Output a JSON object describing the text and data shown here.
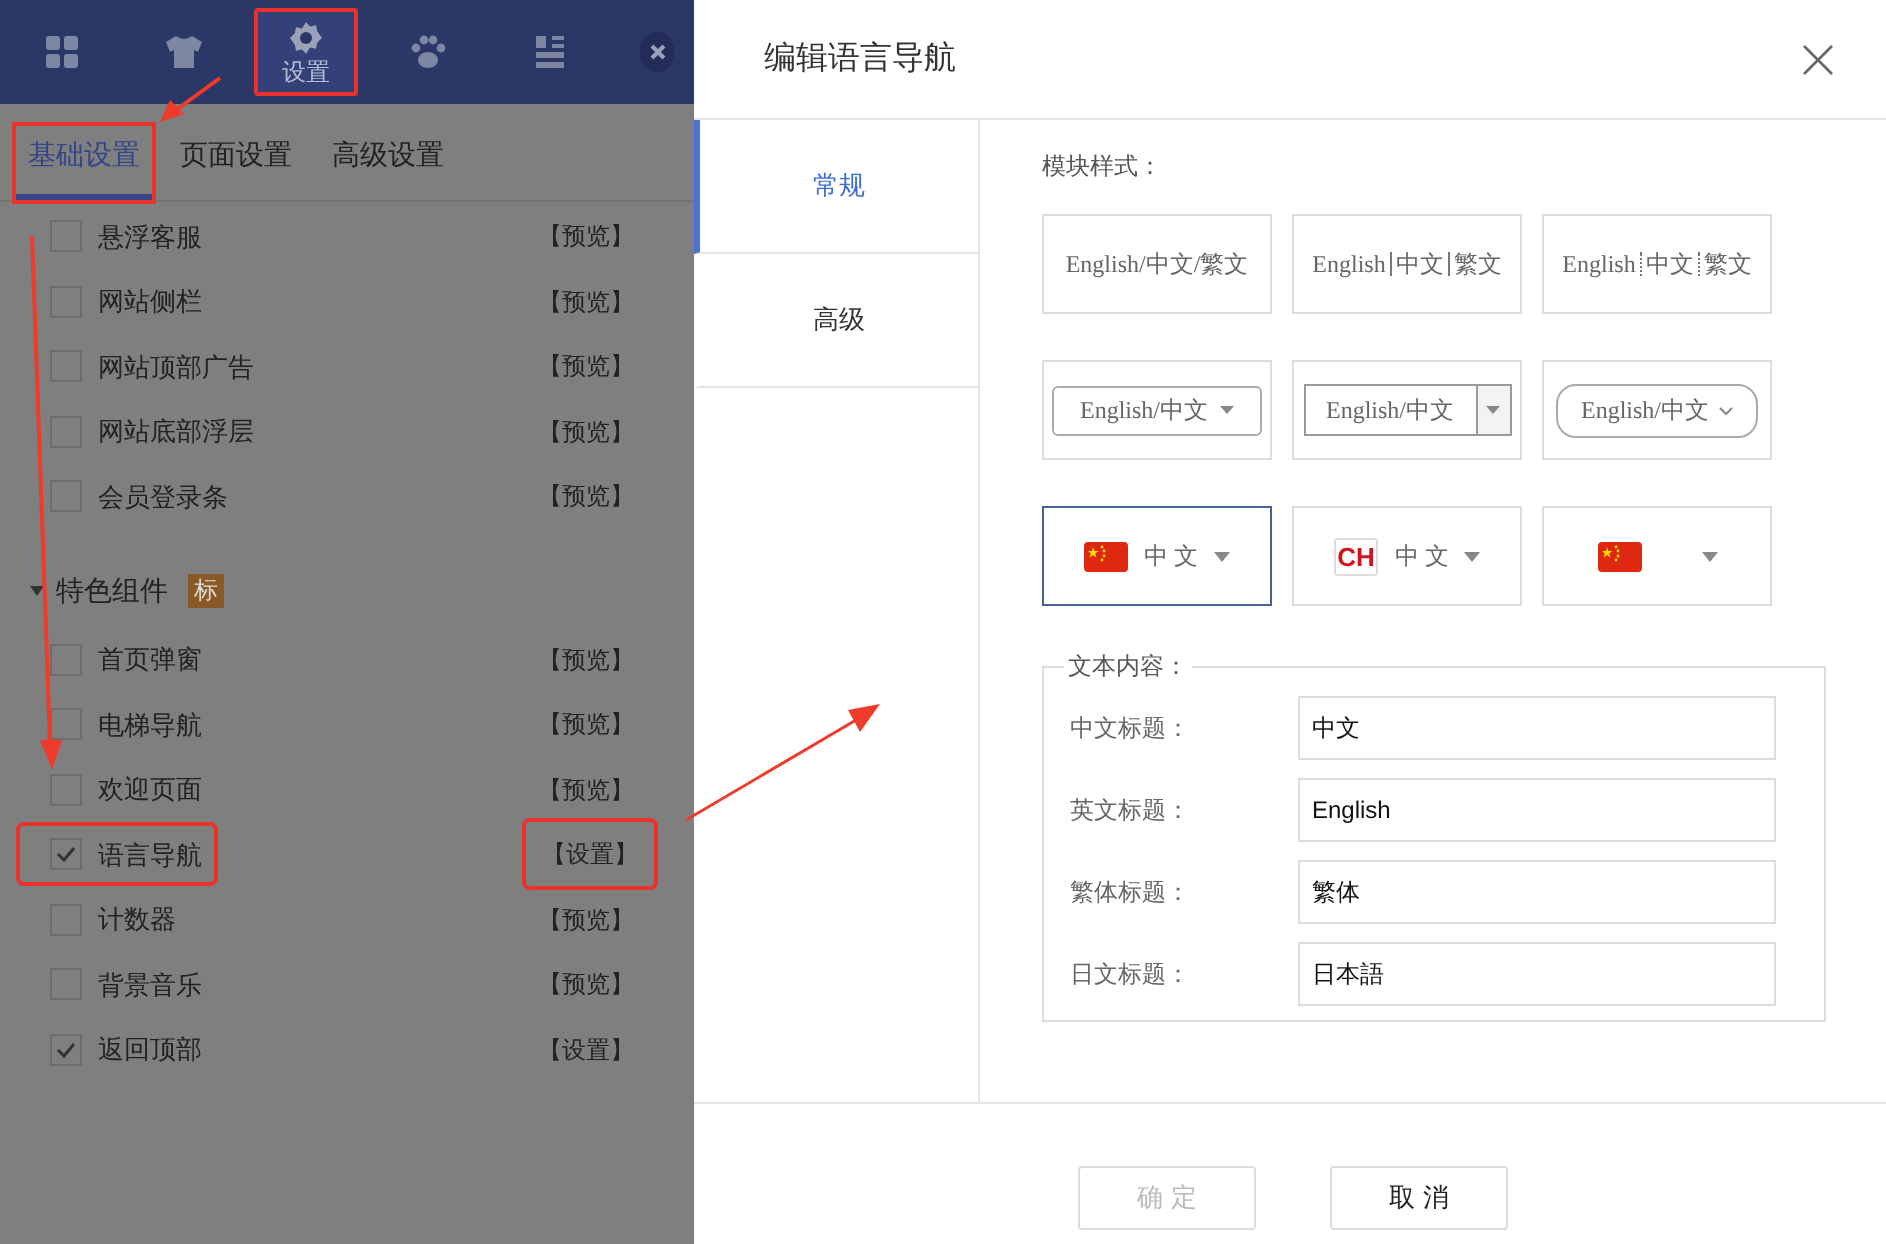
{
  "toolbar": {
    "tabs": [
      {
        "selected": false,
        "highlighted": false
      },
      {
        "selected": false,
        "highlighted": false
      },
      {
        "label": "设置",
        "selected": true,
        "highlighted": true
      },
      {
        "selected": false,
        "highlighted": false
      },
      {
        "selected": false,
        "highlighted": false
      }
    ]
  },
  "sub_tabs": [
    {
      "label": "基础设置",
      "selected": true,
      "highlighted": true
    },
    {
      "label": "页面设置",
      "selected": false,
      "highlighted": false
    },
    {
      "label": "高级设置",
      "selected": false,
      "highlighted": false
    }
  ],
  "components": [
    {
      "name": "悬浮客服",
      "checked": false,
      "action": "【预览】",
      "highlighted": false
    },
    {
      "name": "网站侧栏",
      "checked": false,
      "action": "【预览】",
      "highlighted": false
    },
    {
      "name": "网站顶部广告",
      "checked": false,
      "action": "【预览】",
      "highlighted": false
    },
    {
      "name": "网站底部浮层",
      "checked": false,
      "action": "【预览】",
      "highlighted": false
    },
    {
      "name": "会员登录条",
      "checked": false,
      "action": "【预览】",
      "highlighted": false
    }
  ],
  "group": {
    "title": "特色组件",
    "badge": "标",
    "expanded": true,
    "items": [
      {
        "name": "首页弹窗",
        "checked": false,
        "action": "【预览】",
        "highlighted": false
      },
      {
        "name": "电梯导航",
        "checked": false,
        "action": "【预览】",
        "highlighted": false
      },
      {
        "name": "欢迎页面",
        "checked": false,
        "action": "【预览】",
        "highlighted": false
      },
      {
        "name": "语言导航",
        "checked": true,
        "action": "【设置】",
        "highlighted": true
      },
      {
        "name": "计数器",
        "checked": false,
        "action": "【预览】",
        "highlighted": false
      },
      {
        "name": "背景音乐",
        "checked": false,
        "action": "【预览】",
        "highlighted": false
      },
      {
        "name": "返回顶部",
        "checked": true,
        "action": "【设置】",
        "highlighted": false
      }
    ]
  },
  "dialog": {
    "title": "编辑语言导航",
    "nav": [
      {
        "label": "常规",
        "selected": true
      },
      {
        "label": "高级",
        "selected": false
      }
    ],
    "style_label": "模块样式：",
    "styles": [
      {
        "kind": "text",
        "label": "English/中文/繁文",
        "selected": false
      },
      {
        "kind": "divided",
        "parts": [
          "English",
          "中文",
          "繁文"
        ],
        "selected": false
      },
      {
        "kind": "divided",
        "parts": [
          "English",
          "中文",
          "繁文"
        ],
        "selected": false
      },
      {
        "kind": "select",
        "label": "English/中文",
        "selected": false
      },
      {
        "kind": "select",
        "label": "English/中文",
        "selected": false
      },
      {
        "kind": "select",
        "label": "English/中文",
        "selected": false
      },
      {
        "kind": "flag",
        "label": "中 文",
        "selected": true
      },
      {
        "kind": "code",
        "code": "CH",
        "label": "中 文",
        "selected": false
      },
      {
        "kind": "flag",
        "selected": false
      }
    ],
    "text_section": {
      "legend": "文本内容：",
      "fields": [
        {
          "label": "中文标题：",
          "value": "中文"
        },
        {
          "label": "英文标题：",
          "value": "English"
        },
        {
          "label": "繁体标题：",
          "value": "繁体"
        },
        {
          "label": "日文标题：",
          "value": "日本語"
        }
      ]
    },
    "buttons": [
      {
        "label": "确 定",
        "disabled": true
      },
      {
        "label": "取 消",
        "disabled": false
      }
    ]
  }
}
